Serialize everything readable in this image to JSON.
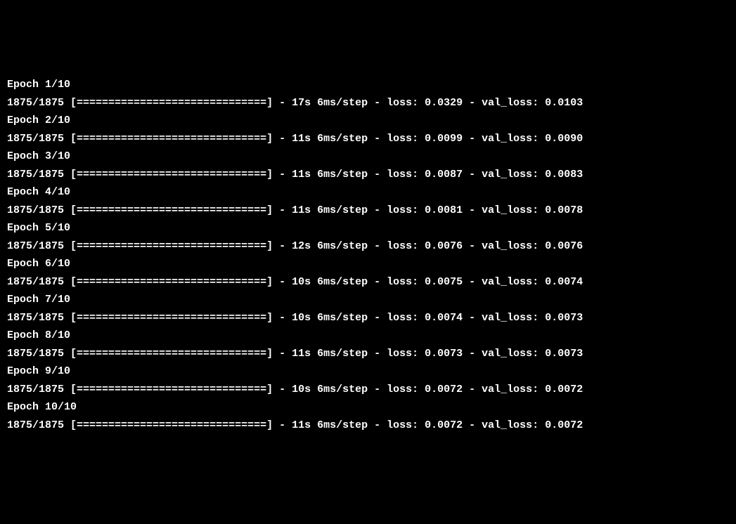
{
  "training": {
    "total_epochs": 10,
    "steps": "1875/1875",
    "progress_bar": "[==============================]",
    "epochs": [
      {
        "label": "Epoch 1/10",
        "time": "17s",
        "per_step": "6ms/step",
        "loss": "0.0329",
        "val_loss": "0.0103"
      },
      {
        "label": "Epoch 2/10",
        "time": "11s",
        "per_step": "6ms/step",
        "loss": "0.0099",
        "val_loss": "0.0090"
      },
      {
        "label": "Epoch 3/10",
        "time": "11s",
        "per_step": "6ms/step",
        "loss": "0.0087",
        "val_loss": "0.0083"
      },
      {
        "label": "Epoch 4/10",
        "time": "11s",
        "per_step": "6ms/step",
        "loss": "0.0081",
        "val_loss": "0.0078"
      },
      {
        "label": "Epoch 5/10",
        "time": "12s",
        "per_step": "6ms/step",
        "loss": "0.0076",
        "val_loss": "0.0076"
      },
      {
        "label": "Epoch 6/10",
        "time": "10s",
        "per_step": "6ms/step",
        "loss": "0.0075",
        "val_loss": "0.0074"
      },
      {
        "label": "Epoch 7/10",
        "time": "10s",
        "per_step": "6ms/step",
        "loss": "0.0074",
        "val_loss": "0.0073"
      },
      {
        "label": "Epoch 8/10",
        "time": "11s",
        "per_step": "6ms/step",
        "loss": "0.0073",
        "val_loss": "0.0073"
      },
      {
        "label": "Epoch 9/10",
        "time": "10s",
        "per_step": "6ms/step",
        "loss": "0.0072",
        "val_loss": "0.0072"
      },
      {
        "label": "Epoch 10/10",
        "time": "11s",
        "per_step": "6ms/step",
        "loss": "0.0072",
        "val_loss": "0.0072"
      }
    ]
  }
}
